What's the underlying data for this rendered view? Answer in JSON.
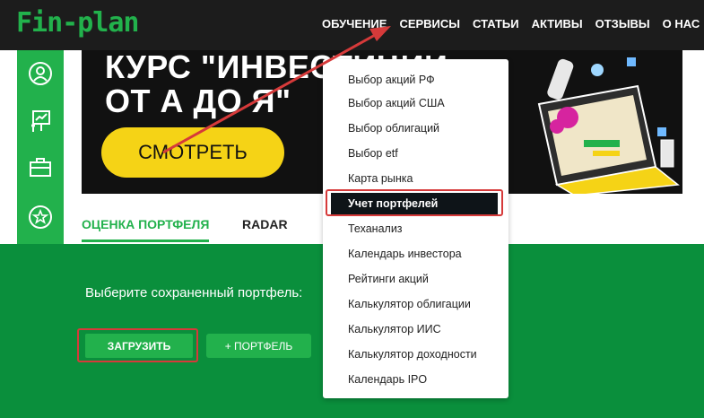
{
  "logo": "Fin-plan",
  "nav": [
    "ОБУЧЕНИЕ",
    "СЕРВИСЫ",
    "СТАТЬИ",
    "АКТИВЫ",
    "ОТЗЫВЫ",
    "О НАС"
  ],
  "sidebar": {
    "icons": [
      "user-icon",
      "presentation-icon",
      "briefcase-icon",
      "star-icon",
      "folder-icon"
    ]
  },
  "banner": {
    "title": "КУРС \"ИНВЕСТИЦИИ\nОТ А ДО Я\"",
    "button": "СМОТРЕТЬ"
  },
  "tabs": {
    "active": "ОЦЕНКА ПОРТФЕЛЯ",
    "second": "RADAR"
  },
  "portfolio": {
    "label": "Выберите сохраненный портфель:",
    "load_button": "ЗАГРУЗИТЬ",
    "add_button": "+ ПОРТФЕЛЬ"
  },
  "dropdown": {
    "items": [
      "Выбор акций РФ",
      "Выбор акций США",
      "Выбор облигаций",
      "Выбор etf",
      "Карта рынка",
      "Учет портфелей",
      "Теханализ",
      "Календарь инвестора",
      "Рейтинги акций",
      "Калькулятор облигации",
      "Калькулятор ИИС",
      "Калькулятор доходности",
      "Календарь IPO"
    ],
    "highlighted": "Учет портфелей"
  },
  "colors": {
    "brand_green": "#22b14c",
    "dark_green": "#0a8f3c",
    "nav_bg": "#1c1c1c",
    "banner_yellow": "#f5d316",
    "annotation_red": "#d63a3a"
  }
}
